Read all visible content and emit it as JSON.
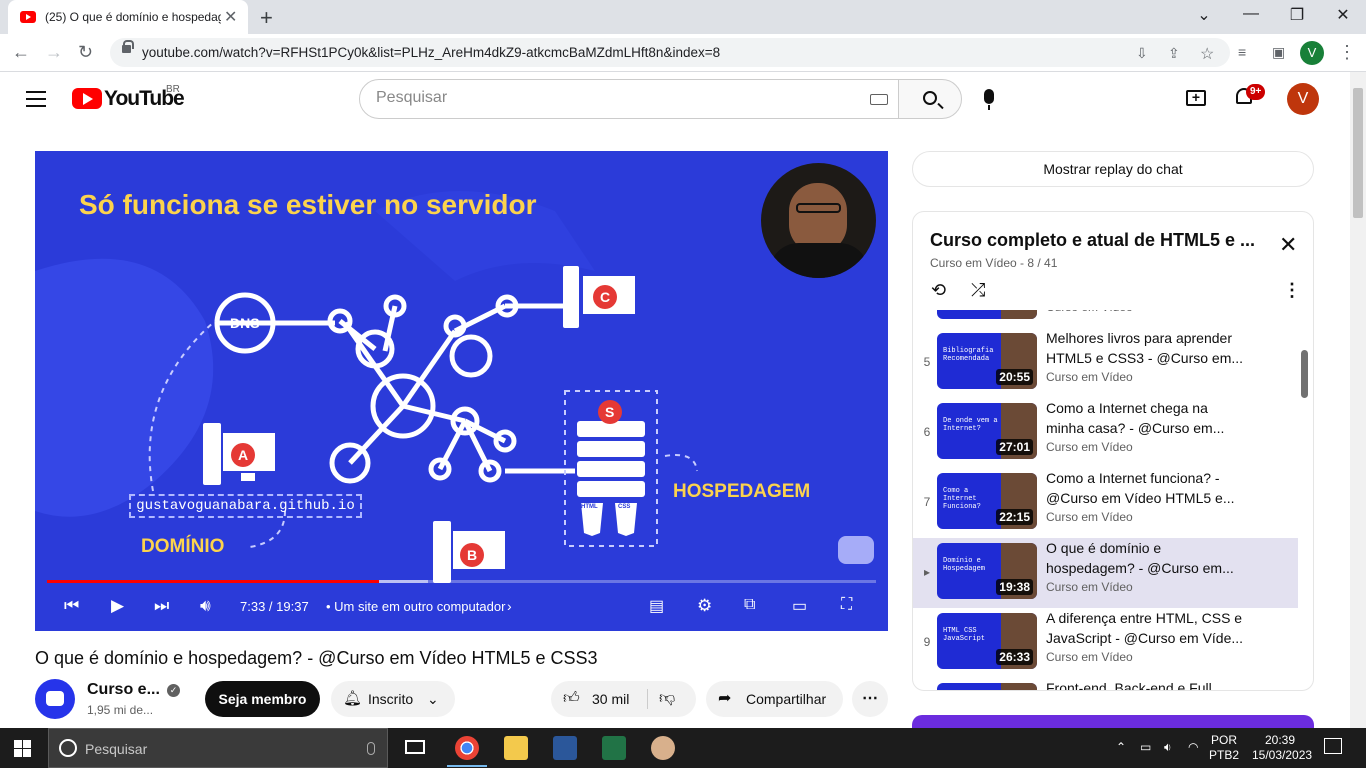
{
  "browser": {
    "tab_title": "(25) O que é domínio e hospedagem? - @Curso em Vídeo HTML5 e CSS3",
    "url": "youtube.com/watch?v=RFHSt1PCy0k&list=PLHz_AreHm4dkZ9-atkcmcBaMZdmLHft8n&index=8",
    "profile_initial": "V"
  },
  "header": {
    "logo_text": "YouTube",
    "country": "BR",
    "search_placeholder": "Pesquisar",
    "notifications": "9+",
    "avatar_initial": "V"
  },
  "player": {
    "slide": {
      "title": "Só funciona se estiver no servidor",
      "dns": "DNS",
      "node_a": "A",
      "node_b": "B",
      "node_c": "C",
      "node_s": "S",
      "domain_url": "gustavoguanabara.github.io",
      "label_domain": "DOMÍNIO",
      "label_hosting": "HOSPEDAGEM",
      "html": "HTML",
      "css": "CSS"
    },
    "time": "7:33 / 19:37",
    "chapter": "• Um site em outro computador",
    "progress_played": 0.4,
    "progress_loaded": 0.46
  },
  "video": {
    "title": "O que é domínio e hospedagem? - @Curso em Vídeo HTML5 e CSS3",
    "channel": "Curso e...",
    "subscribers": "1,95 mi de...",
    "member_label": "Seja membro",
    "subscribed_label": "Inscrito",
    "likes": "30 mil",
    "share_label": "Compartilhar"
  },
  "sidebar": {
    "replay_label": "Mostrar replay do chat",
    "playlist": {
      "title": "Curso completo e atual de HTML5 e ...",
      "subtitle": "Curso em Vídeo - 8 / 41",
      "items": [
        {
          "index": "",
          "title": "",
          "channel": "Curso em Vídeo",
          "duration": "",
          "thumb": ""
        },
        {
          "index": "5",
          "title": "Melhores livros para aprender HTML5 e CSS3 - @Curso em...",
          "channel": "Curso em Vídeo",
          "duration": "20:55",
          "thumb": "Bibliografia Recomendada"
        },
        {
          "index": "6",
          "title": "Como a Internet chega na minha casa? - @Curso em...",
          "channel": "Curso em Vídeo",
          "duration": "27:01",
          "thumb": "De onde vem a Internet?"
        },
        {
          "index": "7",
          "title": "Como a Internet funciona? - @Curso em Vídeo HTML5 e...",
          "channel": "Curso em Vídeo",
          "duration": "22:15",
          "thumb": "Como a Internet Funciona?"
        },
        {
          "index": "▸",
          "title": "O que é domínio e hospedagem? - @Curso em...",
          "channel": "Curso em Vídeo",
          "duration": "19:38",
          "thumb": "Domínio e Hospedagem"
        },
        {
          "index": "9",
          "title": "A diferença entre HTML, CSS e JavaScript - @Curso em Víde...",
          "channel": "Curso em Vídeo",
          "duration": "26:33",
          "thumb": "HTML CSS JavaScript"
        },
        {
          "index": "",
          "title": "Front-end, Back-end e Full...",
          "channel": "",
          "duration": "",
          "thumb": ""
        }
      ]
    }
  },
  "taskbar": {
    "search_placeholder": "Pesquisar",
    "lang_1": "POR",
    "lang_2": "PTB2",
    "time": "20:39",
    "date": "15/03/2023"
  },
  "colors": {
    "youtube_red": "#ff0000",
    "slide_blue": "#2b3bd9",
    "slide_yellow": "#fcd34d",
    "active_item": "#e3e1f0"
  }
}
